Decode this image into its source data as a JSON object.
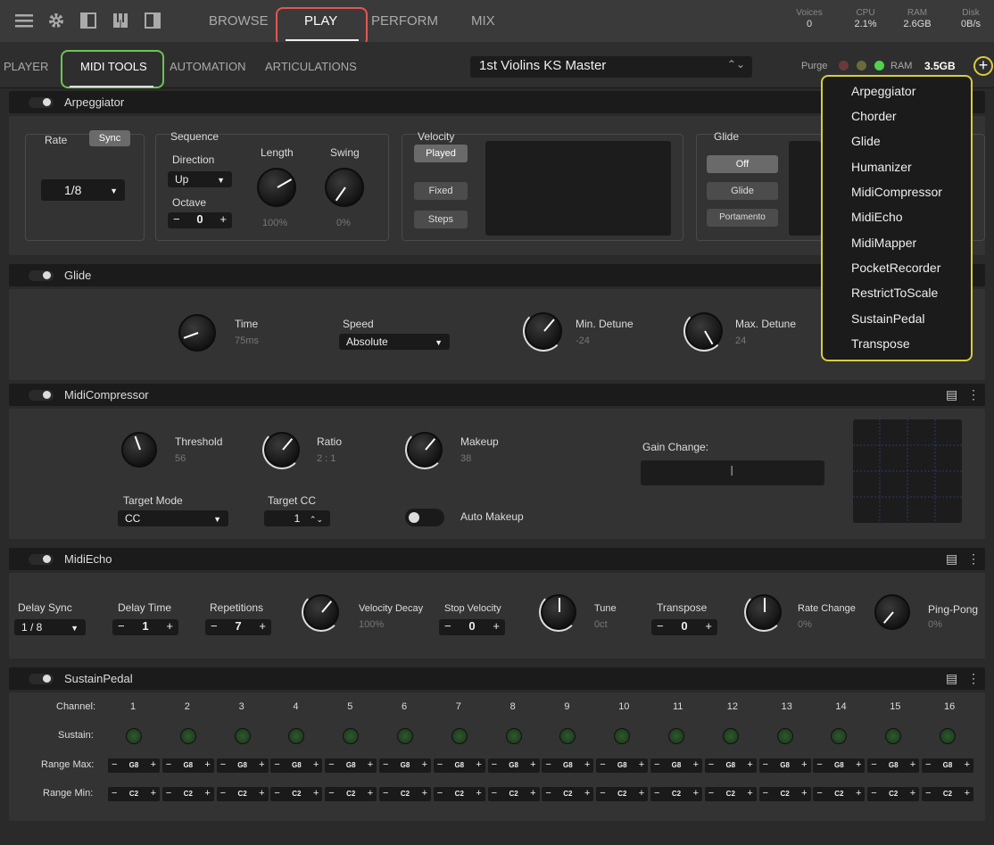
{
  "topbar": {
    "nav": [
      "BROWSE",
      "PLAY",
      "PERFORM",
      "MIX"
    ],
    "stats": [
      {
        "label": "Voices",
        "value": "0"
      },
      {
        "label": "CPU",
        "value": "2.1%"
      },
      {
        "label": "RAM",
        "value": "2.6GB"
      },
      {
        "label": "Disk",
        "value": "0B/s"
      }
    ]
  },
  "subbar": {
    "tabs": [
      "PLAYER",
      "MIDI TOOLS",
      "AUTOMATION",
      "ARTICULATIONS"
    ],
    "instrument": "1st Violins KS Master",
    "purge": "Purge",
    "ram_label": "RAM",
    "ram_value": "3.5GB",
    "add": "+"
  },
  "sections": {
    "arp": {
      "title": "Arpeggiator",
      "rate": "Rate",
      "sync": "Sync",
      "rate_value": "1/8",
      "sequence": "Sequence",
      "direction": "Direction",
      "dir_value": "Up",
      "octave": "Octave",
      "oct_value": "0",
      "length": "Length",
      "length_value": "100%",
      "swing": "Swing",
      "swing_value": "0%",
      "velocity": "Velocity",
      "vel_buttons": [
        "Played",
        "Fixed",
        "Steps"
      ],
      "glide": "Glide",
      "glide_buttons": [
        "Off",
        "Glide",
        "Portamento"
      ]
    },
    "glide": {
      "title": "Glide",
      "time": "Time",
      "time_value": "75ms",
      "speed": "Speed",
      "speed_value": "Absolute",
      "min_detune": "Min. Detune",
      "min_value": "-24",
      "max_detune": "Max. Detune",
      "max_value": "24"
    },
    "comp": {
      "title": "MidiCompressor",
      "threshold": "Threshold",
      "threshold_value": "56",
      "ratio": "Ratio",
      "ratio_value": "2 : 1",
      "makeup": "Makeup",
      "makeup_value": "38",
      "gain_change": "Gain Change:",
      "target_mode": "Target Mode",
      "target_mode_value": "CC",
      "target_cc": "Target CC",
      "target_cc_value": "1",
      "auto_makeup": "Auto Makeup"
    },
    "echo": {
      "title": "MidiEcho",
      "delay_sync": "Delay Sync",
      "delay_sync_value": "1 / 8",
      "delay_time": "Delay Time",
      "delay_time_value": "1",
      "repetitions": "Repetitions",
      "repetitions_value": "7",
      "vel_decay": "Velocity Decay",
      "vel_decay_value": "100%",
      "stop_velocity": "Stop Velocity",
      "stop_velocity_value": "0",
      "tune": "Tune",
      "tune_value": "0ct",
      "transpose": "Transpose",
      "transpose_value": "0",
      "rate_change": "Rate Change",
      "rate_change_value": "0%",
      "ping_pong": "Ping-Pong",
      "ping_pong_value": "0%"
    },
    "sustain": {
      "title": "SustainPedal",
      "channel": "Channel:",
      "sustain": "Sustain:",
      "range_max": "Range Max:",
      "range_min": "Range Min:",
      "channels": [
        "1",
        "2",
        "3",
        "4",
        "5",
        "6",
        "7",
        "8",
        "9",
        "10",
        "11",
        "12",
        "13",
        "14",
        "15",
        "16"
      ],
      "max_value": "G8",
      "min_value": "C2"
    }
  },
  "menu": {
    "items": [
      "Arpeggiator",
      "Chorder",
      "Glide",
      "Humanizer",
      "MidiCompressor",
      "MidiEcho",
      "MidiMapper",
      "PocketRecorder",
      "RestrictToScale",
      "SustainPedal",
      "Transpose"
    ]
  },
  "colors": {
    "play_highlight": "#e2584f",
    "midi_highlight": "#6cc54f",
    "menu_highlight": "#d8cd3a"
  }
}
